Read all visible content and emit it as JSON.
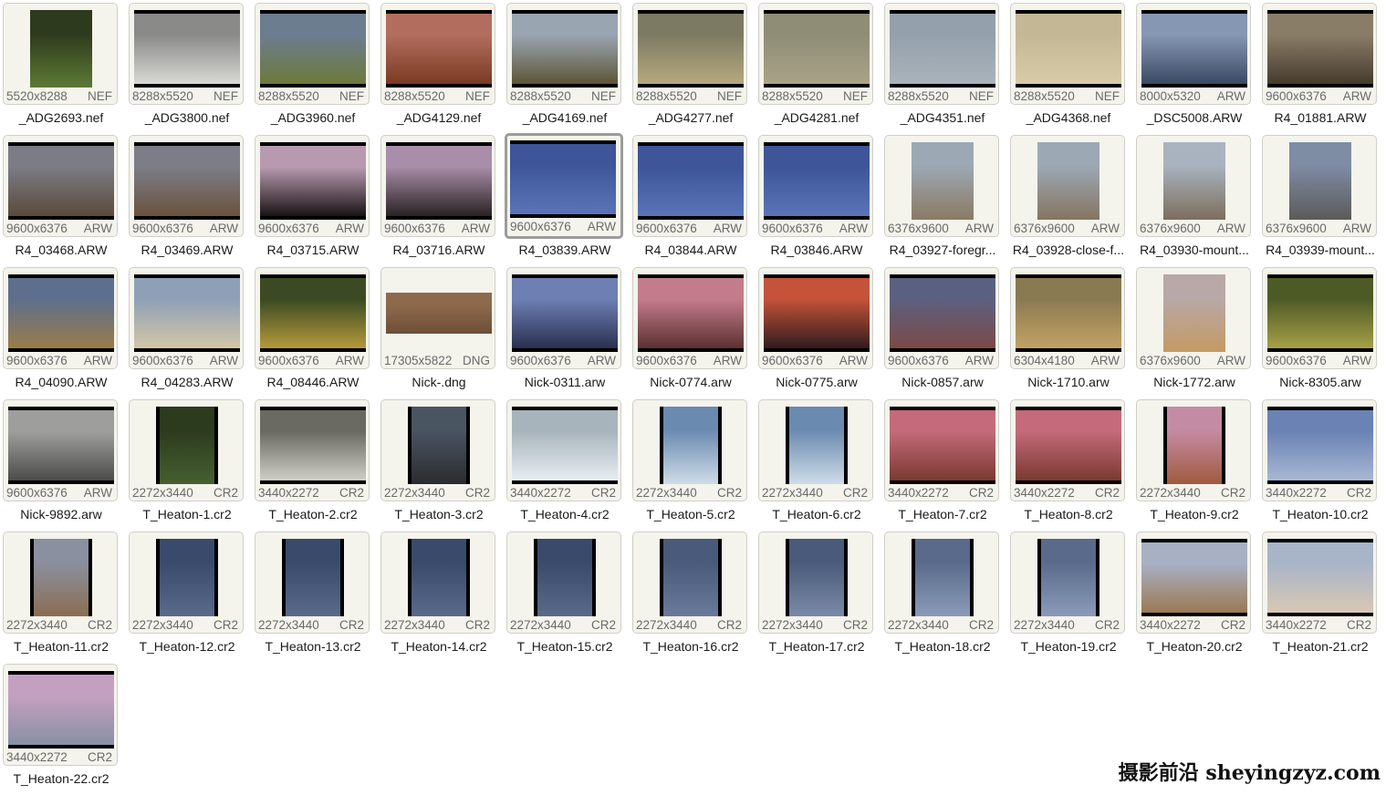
{
  "files": [
    {
      "name": "_ADG2693.nef",
      "dims": "5520x8288",
      "fmt": "NEF",
      "orient": "portrait",
      "colors": [
        "#2e3a1d",
        "#5c7a35"
      ]
    },
    {
      "name": "_ADG3800.nef",
      "dims": "8288x5520",
      "fmt": "NEF",
      "orient": "landscape",
      "colors": [
        "#8a8a88",
        "#d8d8d4"
      ]
    },
    {
      "name": "_ADG3960.nef",
      "dims": "8288x5520",
      "fmt": "NEF",
      "orient": "landscape",
      "colors": [
        "#6c7d90",
        "#6d7a3a"
      ]
    },
    {
      "name": "_ADG4129.nef",
      "dims": "8288x5520",
      "fmt": "NEF",
      "orient": "landscape",
      "colors": [
        "#b36d5e",
        "#7a3a22"
      ]
    },
    {
      "name": "_ADG4169.nef",
      "dims": "8288x5520",
      "fmt": "NEF",
      "orient": "landscape",
      "colors": [
        "#9aa5b2",
        "#5d5536"
      ]
    },
    {
      "name": "_ADG4277.nef",
      "dims": "8288x5520",
      "fmt": "NEF",
      "orient": "landscape",
      "colors": [
        "#7d7a63",
        "#b5a97e"
      ]
    },
    {
      "name": "_ADG4281.nef",
      "dims": "8288x5520",
      "fmt": "NEF",
      "orient": "landscape",
      "colors": [
        "#8f8d76",
        "#a9a387"
      ]
    },
    {
      "name": "_ADG4351.nef",
      "dims": "8288x5520",
      "fmt": "NEF",
      "orient": "landscape",
      "colors": [
        "#94a0ac",
        "#aab3bb"
      ]
    },
    {
      "name": "_ADG4368.nef",
      "dims": "8288x5520",
      "fmt": "NEF",
      "orient": "landscape",
      "colors": [
        "#c4b795",
        "#d8cca8"
      ]
    },
    {
      "name": "_DSC5008.ARW",
      "dims": "8000x5320",
      "fmt": "ARW",
      "orient": "landscape",
      "colors": [
        "#8697b3",
        "#3b4a63"
      ]
    },
    {
      "name": "R4_01881.ARW",
      "dims": "9600x6376",
      "fmt": "ARW",
      "orient": "landscape",
      "colors": [
        "#8a7d68",
        "#453b2d"
      ]
    },
    {
      "name": "R4_03468.ARW",
      "dims": "9600x6376",
      "fmt": "ARW",
      "orient": "landscape",
      "colors": [
        "#7b7c84",
        "#5b4a3c"
      ]
    },
    {
      "name": "R4_03469.ARW",
      "dims": "9600x6376",
      "fmt": "ARW",
      "orient": "landscape",
      "colors": [
        "#7c7d86",
        "#6a5240"
      ]
    },
    {
      "name": "R4_03715.ARW",
      "dims": "9600x6376",
      "fmt": "ARW",
      "orient": "landscape",
      "colors": [
        "#b89ab0",
        "#1a1414"
      ]
    },
    {
      "name": "R4_03716.ARW",
      "dims": "9600x6376",
      "fmt": "ARW",
      "orient": "landscape",
      "colors": [
        "#a88ea8",
        "#2a2222"
      ]
    },
    {
      "name": "R4_03839.ARW",
      "dims": "9600x6376",
      "fmt": "ARW",
      "orient": "landscape",
      "colors": [
        "#3e559a",
        "#5a74b8"
      ]
    },
    {
      "name": "R4_03844.ARW",
      "dims": "9600x6376",
      "fmt": "ARW",
      "orient": "landscape",
      "colors": [
        "#3e559a",
        "#5a74b8"
      ]
    },
    {
      "name": "R4_03846.ARW",
      "dims": "9600x6376",
      "fmt": "ARW",
      "orient": "landscape",
      "colors": [
        "#3e559a",
        "#5a74b8"
      ]
    },
    {
      "name": "R4_03927-foregr...",
      "dims": "6376x9600",
      "fmt": "ARW",
      "orient": "portrait",
      "colors": [
        "#9da8b5",
        "#8a7a62"
      ]
    },
    {
      "name": "R4_03928-close-f...",
      "dims": "6376x9600",
      "fmt": "ARW",
      "orient": "portrait",
      "colors": [
        "#9da8b5",
        "#857560"
      ]
    },
    {
      "name": "R4_03930-mount...",
      "dims": "6376x9600",
      "fmt": "ARW",
      "orient": "portrait",
      "colors": [
        "#a9b3bf",
        "#7c6e5c"
      ]
    },
    {
      "name": "R4_03939-mount...",
      "dims": "6376x9600",
      "fmt": "ARW",
      "orient": "portrait",
      "colors": [
        "#7e8ca4",
        "#5c5a5a"
      ]
    },
    {
      "name": "R4_04090.ARW",
      "dims": "9600x6376",
      "fmt": "ARW",
      "orient": "landscape",
      "colors": [
        "#5d6f8c",
        "#9a7c4a"
      ]
    },
    {
      "name": "R4_04283.ARW",
      "dims": "9600x6376",
      "fmt": "ARW",
      "orient": "landscape",
      "colors": [
        "#8fa0b6",
        "#d3c6a8"
      ]
    },
    {
      "name": "R4_08446.ARW",
      "dims": "9600x6376",
      "fmt": "ARW",
      "orient": "landscape",
      "colors": [
        "#3b4a22",
        "#b59a3c"
      ]
    },
    {
      "name": "Nick-.dng",
      "dims": "17305x5822",
      "fmt": "DNG",
      "orient": "pano",
      "colors": [
        "#8d6a4c",
        "#6d4e38"
      ]
    },
    {
      "name": "Nick-0311.arw",
      "dims": "9600x6376",
      "fmt": "ARW",
      "orient": "landscape",
      "colors": [
        "#6e7fb4",
        "#2a3050"
      ]
    },
    {
      "name": "Nick-0774.arw",
      "dims": "9600x6376",
      "fmt": "ARW",
      "orient": "landscape",
      "colors": [
        "#c37c8c",
        "#5c3030"
      ]
    },
    {
      "name": "Nick-0775.arw",
      "dims": "9600x6376",
      "fmt": "ARW",
      "orient": "landscape",
      "colors": [
        "#c4533a",
        "#301c1c"
      ]
    },
    {
      "name": "Nick-0857.arw",
      "dims": "9600x6376",
      "fmt": "ARW",
      "orient": "landscape",
      "colors": [
        "#5c6080",
        "#7a4a46"
      ]
    },
    {
      "name": "Nick-1710.arw",
      "dims": "6304x4180",
      "fmt": "ARW",
      "orient": "landscape",
      "colors": [
        "#8a7a52",
        "#c2a264"
      ]
    },
    {
      "name": "Nick-1772.arw",
      "dims": "6376x9600",
      "fmt": "ARW",
      "orient": "portrait",
      "colors": [
        "#b8a8a8",
        "#c49a62"
      ]
    },
    {
      "name": "Nick-8305.arw",
      "dims": "9600x6376",
      "fmt": "ARW",
      "orient": "landscape",
      "colors": [
        "#4e5a26",
        "#a6a048"
      ]
    },
    {
      "name": "Nick-9892.arw",
      "dims": "9600x6376",
      "fmt": "ARW",
      "orient": "landscape",
      "colors": [
        "#9e9e9c",
        "#4c4c4c"
      ]
    },
    {
      "name": "T_Heaton-1.cr2",
      "dims": "2272x3440",
      "fmt": "CR2",
      "orient": "portrait-bars",
      "colors": [
        "#2c3a1e",
        "#466030"
      ]
    },
    {
      "name": "T_Heaton-2.cr2",
      "dims": "3440x2272",
      "fmt": "CR2",
      "orient": "landscape",
      "colors": [
        "#6a6a62",
        "#cfcfc8"
      ]
    },
    {
      "name": "T_Heaton-3.cr2",
      "dims": "2272x3440",
      "fmt": "CR2",
      "orient": "portrait-bars",
      "colors": [
        "#4a5562",
        "#2a2c2e"
      ]
    },
    {
      "name": "T_Heaton-4.cr2",
      "dims": "3440x2272",
      "fmt": "CR2",
      "orient": "landscape",
      "colors": [
        "#a8b4bc",
        "#e8eef2"
      ]
    },
    {
      "name": "T_Heaton-5.cr2",
      "dims": "2272x3440",
      "fmt": "CR2",
      "orient": "portrait-bars",
      "colors": [
        "#6a8ab0",
        "#cfdce8"
      ]
    },
    {
      "name": "T_Heaton-6.cr2",
      "dims": "2272x3440",
      "fmt": "CR2",
      "orient": "portrait-bars",
      "colors": [
        "#6a8ab0",
        "#cfdce8"
      ]
    },
    {
      "name": "T_Heaton-7.cr2",
      "dims": "3440x2272",
      "fmt": "CR2",
      "orient": "landscape",
      "colors": [
        "#c46a7a",
        "#7a3a30"
      ]
    },
    {
      "name": "T_Heaton-8.cr2",
      "dims": "3440x2272",
      "fmt": "CR2",
      "orient": "landscape",
      "colors": [
        "#c46a7a",
        "#7a3a30"
      ]
    },
    {
      "name": "T_Heaton-9.cr2",
      "dims": "2272x3440",
      "fmt": "CR2",
      "orient": "portrait-bars",
      "colors": [
        "#c48ca4",
        "#a05a40"
      ]
    },
    {
      "name": "T_Heaton-10.cr2",
      "dims": "3440x2272",
      "fmt": "CR2",
      "orient": "landscape",
      "colors": [
        "#6a82b4",
        "#a8b8d4"
      ]
    },
    {
      "name": "T_Heaton-11.cr2",
      "dims": "2272x3440",
      "fmt": "CR2",
      "orient": "portrait-bars",
      "colors": [
        "#8a90a0",
        "#8a6e52"
      ]
    },
    {
      "name": "T_Heaton-12.cr2",
      "dims": "2272x3440",
      "fmt": "CR2",
      "orient": "portrait-bars",
      "colors": [
        "#3a4a6a",
        "#5a6a8a"
      ]
    },
    {
      "name": "T_Heaton-13.cr2",
      "dims": "2272x3440",
      "fmt": "CR2",
      "orient": "portrait-bars",
      "colors": [
        "#3a4a6a",
        "#5a6a8a"
      ]
    },
    {
      "name": "T_Heaton-14.cr2",
      "dims": "2272x3440",
      "fmt": "CR2",
      "orient": "portrait-bars",
      "colors": [
        "#3a4a6a",
        "#5a6a8a"
      ]
    },
    {
      "name": "T_Heaton-15.cr2",
      "dims": "2272x3440",
      "fmt": "CR2",
      "orient": "portrait-bars",
      "colors": [
        "#3a4a6a",
        "#5a6a8a"
      ]
    },
    {
      "name": "T_Heaton-16.cr2",
      "dims": "2272x3440",
      "fmt": "CR2",
      "orient": "portrait-bars",
      "colors": [
        "#4a5a7a",
        "#6a7a9a"
      ]
    },
    {
      "name": "T_Heaton-17.cr2",
      "dims": "2272x3440",
      "fmt": "CR2",
      "orient": "portrait-bars",
      "colors": [
        "#4a5a7a",
        "#7a8aa8"
      ]
    },
    {
      "name": "T_Heaton-18.cr2",
      "dims": "2272x3440",
      "fmt": "CR2",
      "orient": "portrait-bars",
      "colors": [
        "#5a6a8a",
        "#8a9ab8"
      ]
    },
    {
      "name": "T_Heaton-19.cr2",
      "dims": "2272x3440",
      "fmt": "CR2",
      "orient": "portrait-bars",
      "colors": [
        "#5a6a8a",
        "#8a9ab8"
      ]
    },
    {
      "name": "T_Heaton-20.cr2",
      "dims": "3440x2272",
      "fmt": "CR2",
      "orient": "landscape",
      "colors": [
        "#a8b0c4",
        "#9a7a52"
      ]
    },
    {
      "name": "T_Heaton-21.cr2",
      "dims": "3440x2272",
      "fmt": "CR2",
      "orient": "landscape",
      "colors": [
        "#a8b4c8",
        "#d8c8b4"
      ]
    },
    {
      "name": "T_Heaton-22.cr2",
      "dims": "3440x2272",
      "fmt": "CR2",
      "orient": "landscape",
      "colors": [
        "#c4a0c0",
        "#8890a4"
      ]
    }
  ],
  "selected_index": 15,
  "watermark": "摄影前沿 sheyingzyz.com"
}
